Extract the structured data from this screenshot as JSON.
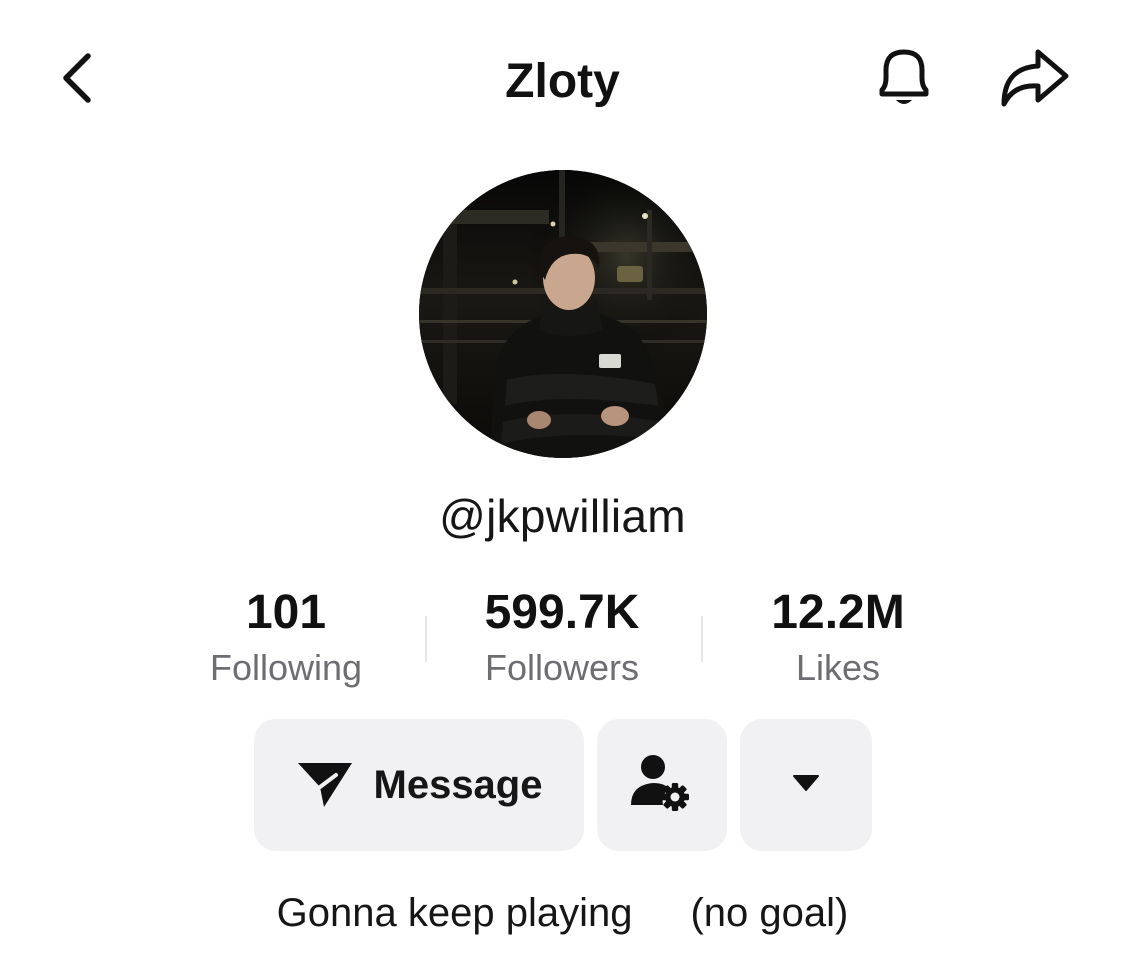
{
  "header": {
    "title": "Zloty",
    "back_icon": "chevron-left-icon",
    "bell_icon": "bell-icon",
    "share_icon": "share-arrow-icon"
  },
  "profile": {
    "handle": "@jkpwilliam",
    "avatar_icon": "profile-photo"
  },
  "stats": [
    {
      "value": "101",
      "label": "Following"
    },
    {
      "value": "599.7K",
      "label": "Followers"
    },
    {
      "value": "12.2M",
      "label": "Likes"
    }
  ],
  "actions": {
    "message_label": "Message",
    "message_icon": "send-icon",
    "person_icon": "person-settings-icon",
    "more_icon": "caret-down-icon"
  },
  "bio": {
    "text_left": "Gonna keep playing",
    "text_right": "(no goal)"
  },
  "colors": {
    "background": "#ffffff",
    "text": "#111111",
    "label": "#6e6e72",
    "button_bg": "#f1f1f3"
  }
}
